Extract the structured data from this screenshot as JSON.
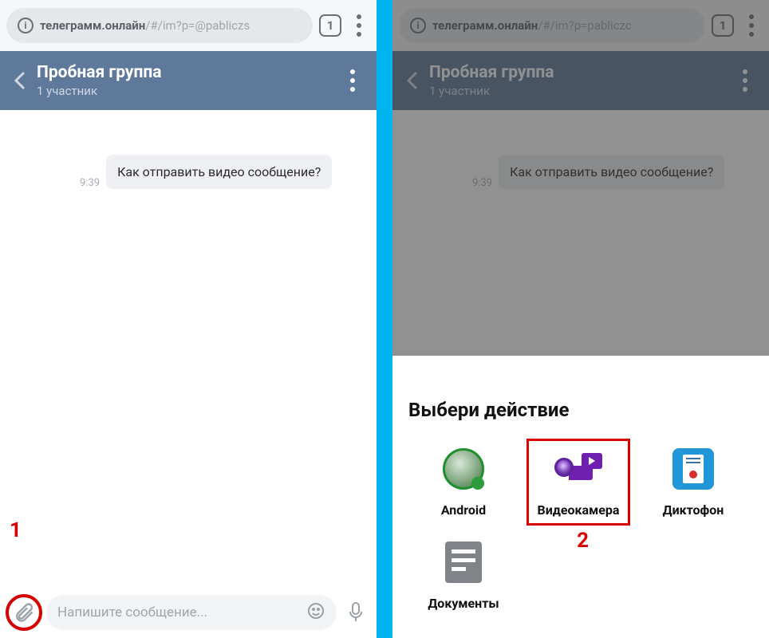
{
  "left": {
    "browser": {
      "url_bold": "телеграмм.онлайн",
      "url_rest": "/#/im?p=@pabliczs",
      "tab_count": "1"
    },
    "chat": {
      "title": "Пробная группа",
      "subtitle": "1 участник"
    },
    "message": {
      "time": "9:39",
      "text": "Как отправить видео сообщение?"
    },
    "input": {
      "placeholder": "Напишите сообщение..."
    },
    "callout": "1"
  },
  "right": {
    "browser": {
      "url_bold": "телеграмм.онлайн",
      "url_rest": "/#/im?p=pabliczc",
      "tab_count": "1"
    },
    "chat": {
      "title": "Пробная группа",
      "subtitle": "1 участник"
    },
    "message": {
      "time": "9:39",
      "text": "Как отправить видео сообщение?"
    },
    "sheet": {
      "title": "Выбери действие",
      "items": [
        {
          "label": "Android"
        },
        {
          "label": "Видеокамера"
        },
        {
          "label": "Диктофон"
        },
        {
          "label": "Документы"
        }
      ],
      "callout": "2"
    }
  }
}
